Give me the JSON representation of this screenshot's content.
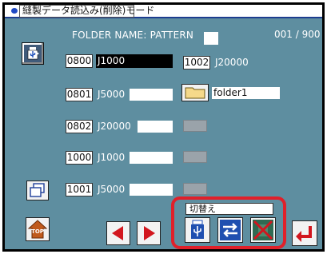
{
  "title": "縫製データ読込み(削除)モード",
  "header": {
    "folder_label": "FOLDER NAME: PATTERN",
    "page_counter": "001 / 900"
  },
  "left_files": [
    {
      "num": "0800",
      "name": "J1000",
      "selected": true
    },
    {
      "num": "0801",
      "name": "J5000",
      "selected": false
    },
    {
      "num": "0802",
      "name": "J20000",
      "selected": false
    },
    {
      "num": "1000",
      "name": "J1000",
      "selected": false
    },
    {
      "num": "1001",
      "name": "J5000",
      "selected": false
    }
  ],
  "right_files": [
    {
      "num": "1002",
      "name": "J20000"
    }
  ],
  "folder": {
    "name": "folder1"
  },
  "switch": {
    "label": "切替え"
  },
  "icons": {
    "usb": "usb-icon",
    "copy": "copy-icon",
    "top": "top-icon",
    "prev": "prev-arrow-icon",
    "next": "next-arrow-icon",
    "swap": "swap-icon",
    "disabled": "disabled-icon",
    "enter": "enter-icon"
  },
  "colors": {
    "screen_bg": "#5e8ea0",
    "accent_red": "#e0202a",
    "selected_bg": "#000000"
  }
}
